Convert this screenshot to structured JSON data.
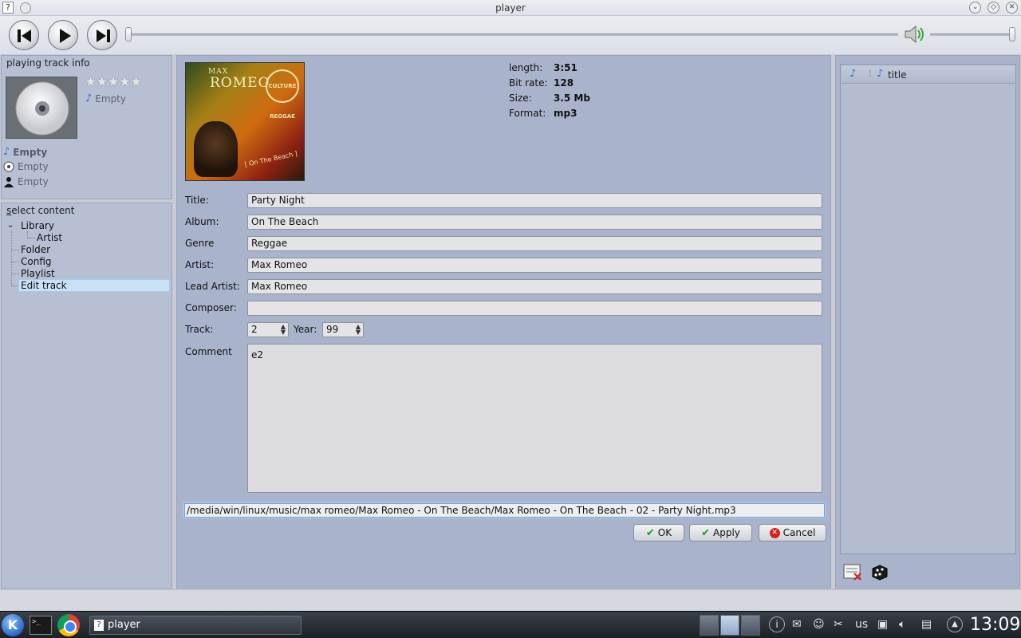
{
  "window": {
    "title": "player",
    "app_icon": "?"
  },
  "toolbar": {
    "prev_icon": "skip-previous-icon",
    "play_icon": "play-icon",
    "next_icon": "skip-next-icon",
    "volume_icon": "speaker-icon"
  },
  "playing_info": {
    "title": "playing track info",
    "rating_stars": [
      "★",
      "★",
      "★",
      "★",
      "★"
    ],
    "rating_value": 0,
    "side_value": "Empty",
    "track": "Empty",
    "album": "Empty",
    "artist": "Empty"
  },
  "content": {
    "title": "select content",
    "title_underline": "s",
    "title_rest": "elect content",
    "items": [
      {
        "label": "Library",
        "expander": "⌄"
      },
      {
        "label": "Artist"
      },
      {
        "label": "Folder"
      },
      {
        "label": "Config"
      },
      {
        "label": "Playlist"
      },
      {
        "label": "Edit track"
      }
    ]
  },
  "editor": {
    "art": {
      "artist": "MAX",
      "name": "ROMEO",
      "seal": "CULTURE REGGAE",
      "album": "[ On The Beach ]"
    },
    "meta": [
      {
        "label": "length:",
        "value": "3:51"
      },
      {
        "label": "Bit rate:",
        "value": "128"
      },
      {
        "label": "Size:",
        "value": "3.5 Mb"
      },
      {
        "label": "Format:",
        "value": "mp3"
      }
    ],
    "fields": [
      {
        "label": "Title:",
        "value": "Party Night"
      },
      {
        "label": "Album:",
        "value": "On The Beach"
      },
      {
        "label": "Genre",
        "value": "Reggae"
      },
      {
        "label": "Artist:",
        "value": "Max Romeo"
      },
      {
        "label": "Lead Artist:",
        "value": "Max Romeo"
      },
      {
        "label": "Composer:",
        "value": ""
      }
    ],
    "track_label": "Track:",
    "track_value": "2",
    "year_label": "Year:",
    "year_value": "99",
    "comment_label": "Comment",
    "comment_value": "e2",
    "path": "/media/win/linux/music/max romeo/Max Romeo - On The Beach/Max Romeo - On The Beach - 02 - Party Night.mp3",
    "buttons": {
      "ok": "OK",
      "apply": "Apply",
      "cancel": "Cancel"
    }
  },
  "playlist": {
    "column_title": "title"
  },
  "taskbar": {
    "task_label": "player",
    "task_icon": "?",
    "terminal_text": ">_",
    "keyboard_layout": "us",
    "clock": "13:09"
  }
}
